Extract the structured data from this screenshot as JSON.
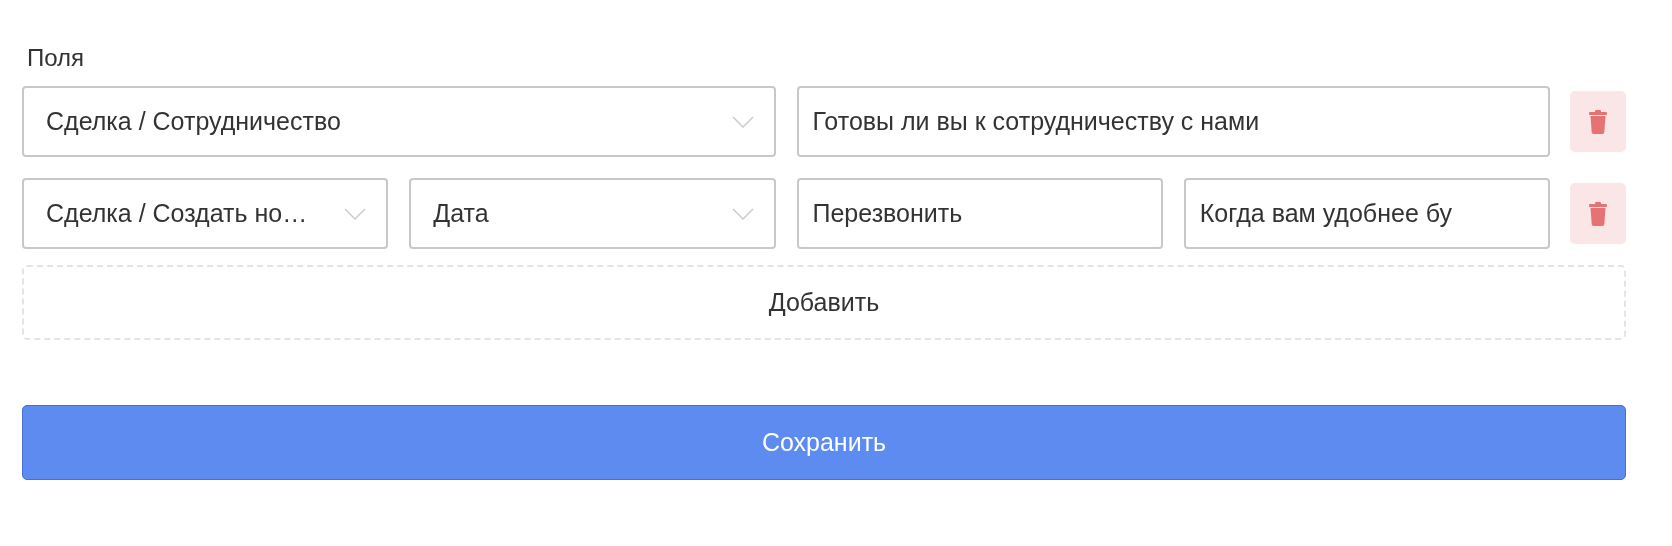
{
  "section_label": "Поля",
  "rows": [
    {
      "fields": [
        {
          "kind": "select",
          "value": "Сделка / Сотрудничество"
        },
        {
          "kind": "input",
          "value": "Готовы ли вы к сотрудничеству с нами"
        }
      ]
    },
    {
      "fields": [
        {
          "kind": "select",
          "value": "Сделка / Создать но…"
        },
        {
          "kind": "select",
          "value": "Дата"
        },
        {
          "kind": "input",
          "value": "Перезвонить"
        },
        {
          "kind": "input",
          "value": "Когда вам удобнее бу"
        }
      ]
    }
  ],
  "add_button": "Добавить",
  "save_button": "Сохранить"
}
